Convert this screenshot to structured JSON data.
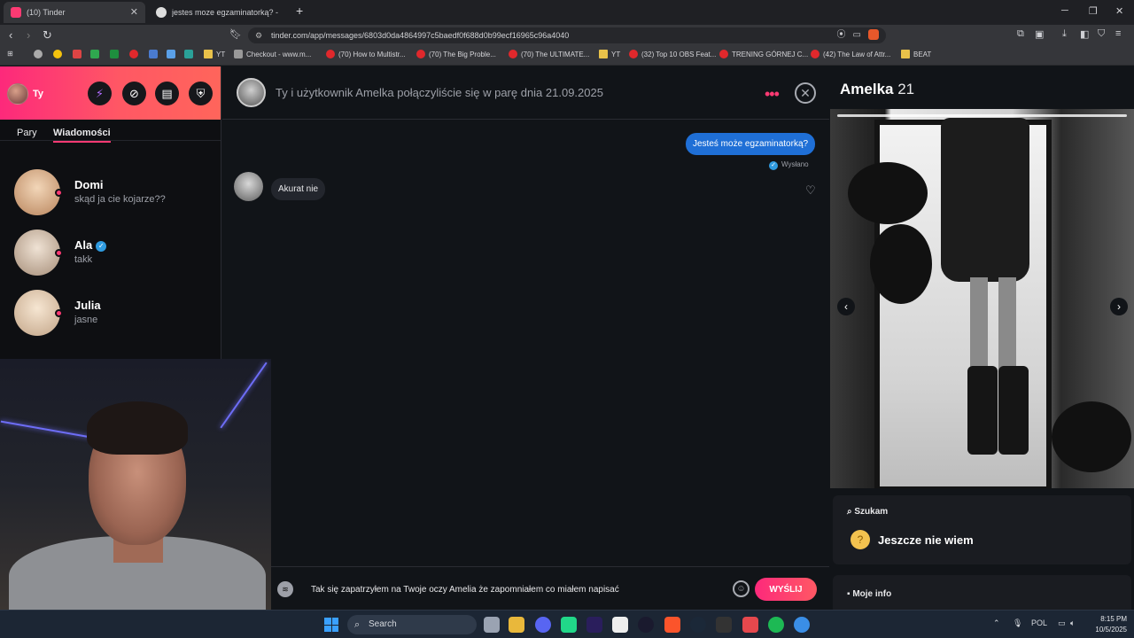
{
  "browser": {
    "tabs": [
      {
        "title": "(10) Tinder",
        "active": true
      },
      {
        "title": "jestes moze egzaminatorką? - Szukaj",
        "active": false
      }
    ],
    "url": "tinder.com/app/messages/6803d0da4864997c5baedf0f688d0b99ecf16965c96a4040",
    "bookmarks": [
      "Checkout - www.m...",
      "(70) How to Multistr...",
      "(70) The Big Proble...",
      "(70) The ULTIMATE...",
      "YT",
      "(32) Top 10 OBS Feat...",
      "TRENING GÓRNEJ C...",
      "(42) The Law of Attr...",
      "BEAT"
    ],
    "bookmarks_first_folder": "YT"
  },
  "sidebar": {
    "me_label": "Ty",
    "tabs": [
      "Pary",
      "Wiadomości"
    ],
    "conversations": [
      {
        "name": "Domi",
        "last": "skąd ja cie kojarze??",
        "verified": false
      },
      {
        "name": "Ala",
        "last": "takk",
        "verified": true
      },
      {
        "name": "Julia",
        "last": "jasne",
        "verified": false
      }
    ]
  },
  "chat": {
    "match_text": "Ty i użytkownik Amelka połączyliście się w parę dnia 21.09.2025",
    "messages": [
      {
        "dir": "out",
        "text": "Jesteś może egzaminatorką?"
      },
      {
        "dir": "in",
        "text": "Akurat nie"
      }
    ],
    "sent_label": "Wysłano",
    "input_value": "Tak się zapatrzyłem na Twoje oczy Amelia że zapomniałem co miałem napisać",
    "send_label": "WYŚLIJ"
  },
  "profile": {
    "name": "Amelka",
    "age": "21",
    "looking_label": "Szukam",
    "looking_value": "Jeszcze nie wiem",
    "myinfo_label": "Moje info"
  },
  "taskbar": {
    "search_label": "Search",
    "lang": "POL",
    "time": "8:15 PM",
    "date": "10/5/2025"
  },
  "colors": {
    "brand_gradient_start": "#fd297b",
    "brand_gradient_end": "#ff655b",
    "outgoing_bubble": "#1f6fd6",
    "accent": "#fd3a73"
  }
}
